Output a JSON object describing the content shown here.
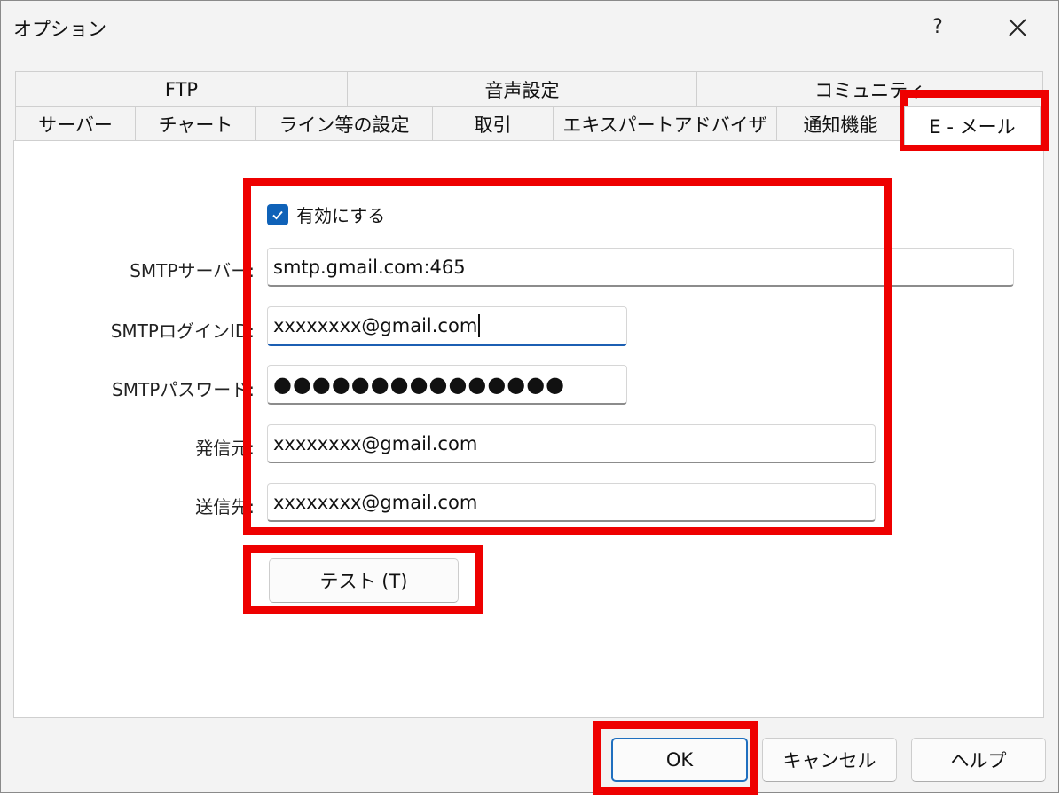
{
  "window": {
    "title": "オプション",
    "help_label": "?"
  },
  "tabs": {
    "top_row": [
      "FTP",
      "音声設定",
      "コミュニティ"
    ],
    "bottom_row": [
      "サーバー",
      "チャート",
      "ライン等の設定",
      "取引",
      "エキスパートアドバイザ",
      "通知機能",
      "E - メール"
    ],
    "active": "E - メール"
  },
  "email": {
    "enable_label": "有効にする",
    "enable_checked": true,
    "fields": [
      {
        "label": "SMTPサーバー:",
        "value": "smtp.gmail.com:465"
      },
      {
        "label": "SMTPログインID:",
        "value": "xxxxxxxx@gmail.com"
      },
      {
        "label": "SMTPパスワード:",
        "value": "●●●●●●●●●●●●●●●"
      },
      {
        "label": "発信元:",
        "value": "xxxxxxxx@gmail.com"
      },
      {
        "label": "送信先:",
        "value": "xxxxxxxx@gmail.com"
      }
    ],
    "test_button": "テスト (T)"
  },
  "footer": {
    "ok": "OK",
    "cancel": "キャンセル",
    "help": "ヘルプ"
  },
  "colors": {
    "highlight": "#ee0000",
    "accent": "#0f62b8"
  }
}
